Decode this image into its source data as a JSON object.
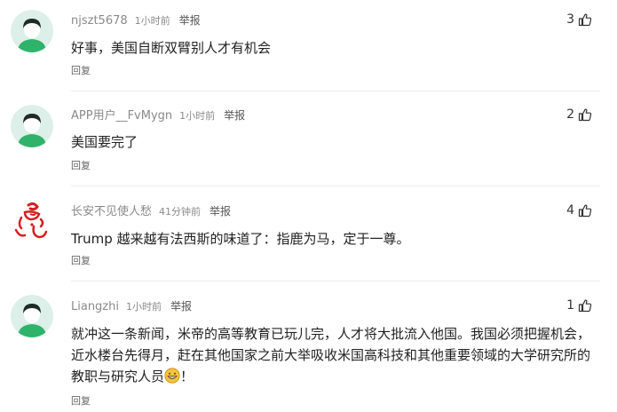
{
  "comments": [
    {
      "username": "njszt5678",
      "time": "1小时前",
      "report_label": "举报",
      "text": "好事，美国自断双臂别人才有机会",
      "reply_label": "回复",
      "likes": "3",
      "avatar": "default-avatar"
    },
    {
      "username": "APP用户__FvMygn",
      "time": "1小时前",
      "report_label": "举报",
      "text": "美国要完了",
      "reply_label": "回复",
      "likes": "2",
      "avatar": "default-avatar"
    },
    {
      "username": "长安不见使人愁",
      "time": "41分钟前",
      "report_label": "举报",
      "text": "Trump 越来越有法西斯的味道了：指鹿为马，定于一尊。",
      "reply_label": "回复",
      "likes": "4",
      "avatar": "red-calligraphy-avatar"
    },
    {
      "username": "Liangzhi",
      "time": "1小时前",
      "report_label": "举报",
      "text": "就冲这一条新闻，米帝的高等教育已玩儿完，人才将大批流入他国。我国必须把握机会，近水楼台先得月，赶在其他国家之前大举吸收米国高科技和其他重要领域的大学研究所的教职与研究人员",
      "text_suffix": "！",
      "inline_emoji": "grin-emoji",
      "reply_label": "回复",
      "likes": "1",
      "avatar": "default-avatar"
    }
  ],
  "colors": {
    "avatar_bg": "#dcefe8",
    "avatar_shirt": "#2fb36a",
    "avatar_hair": "#1f2a2a",
    "avatar_face": "#ffffff",
    "calligraphy_red": "#d42020"
  }
}
